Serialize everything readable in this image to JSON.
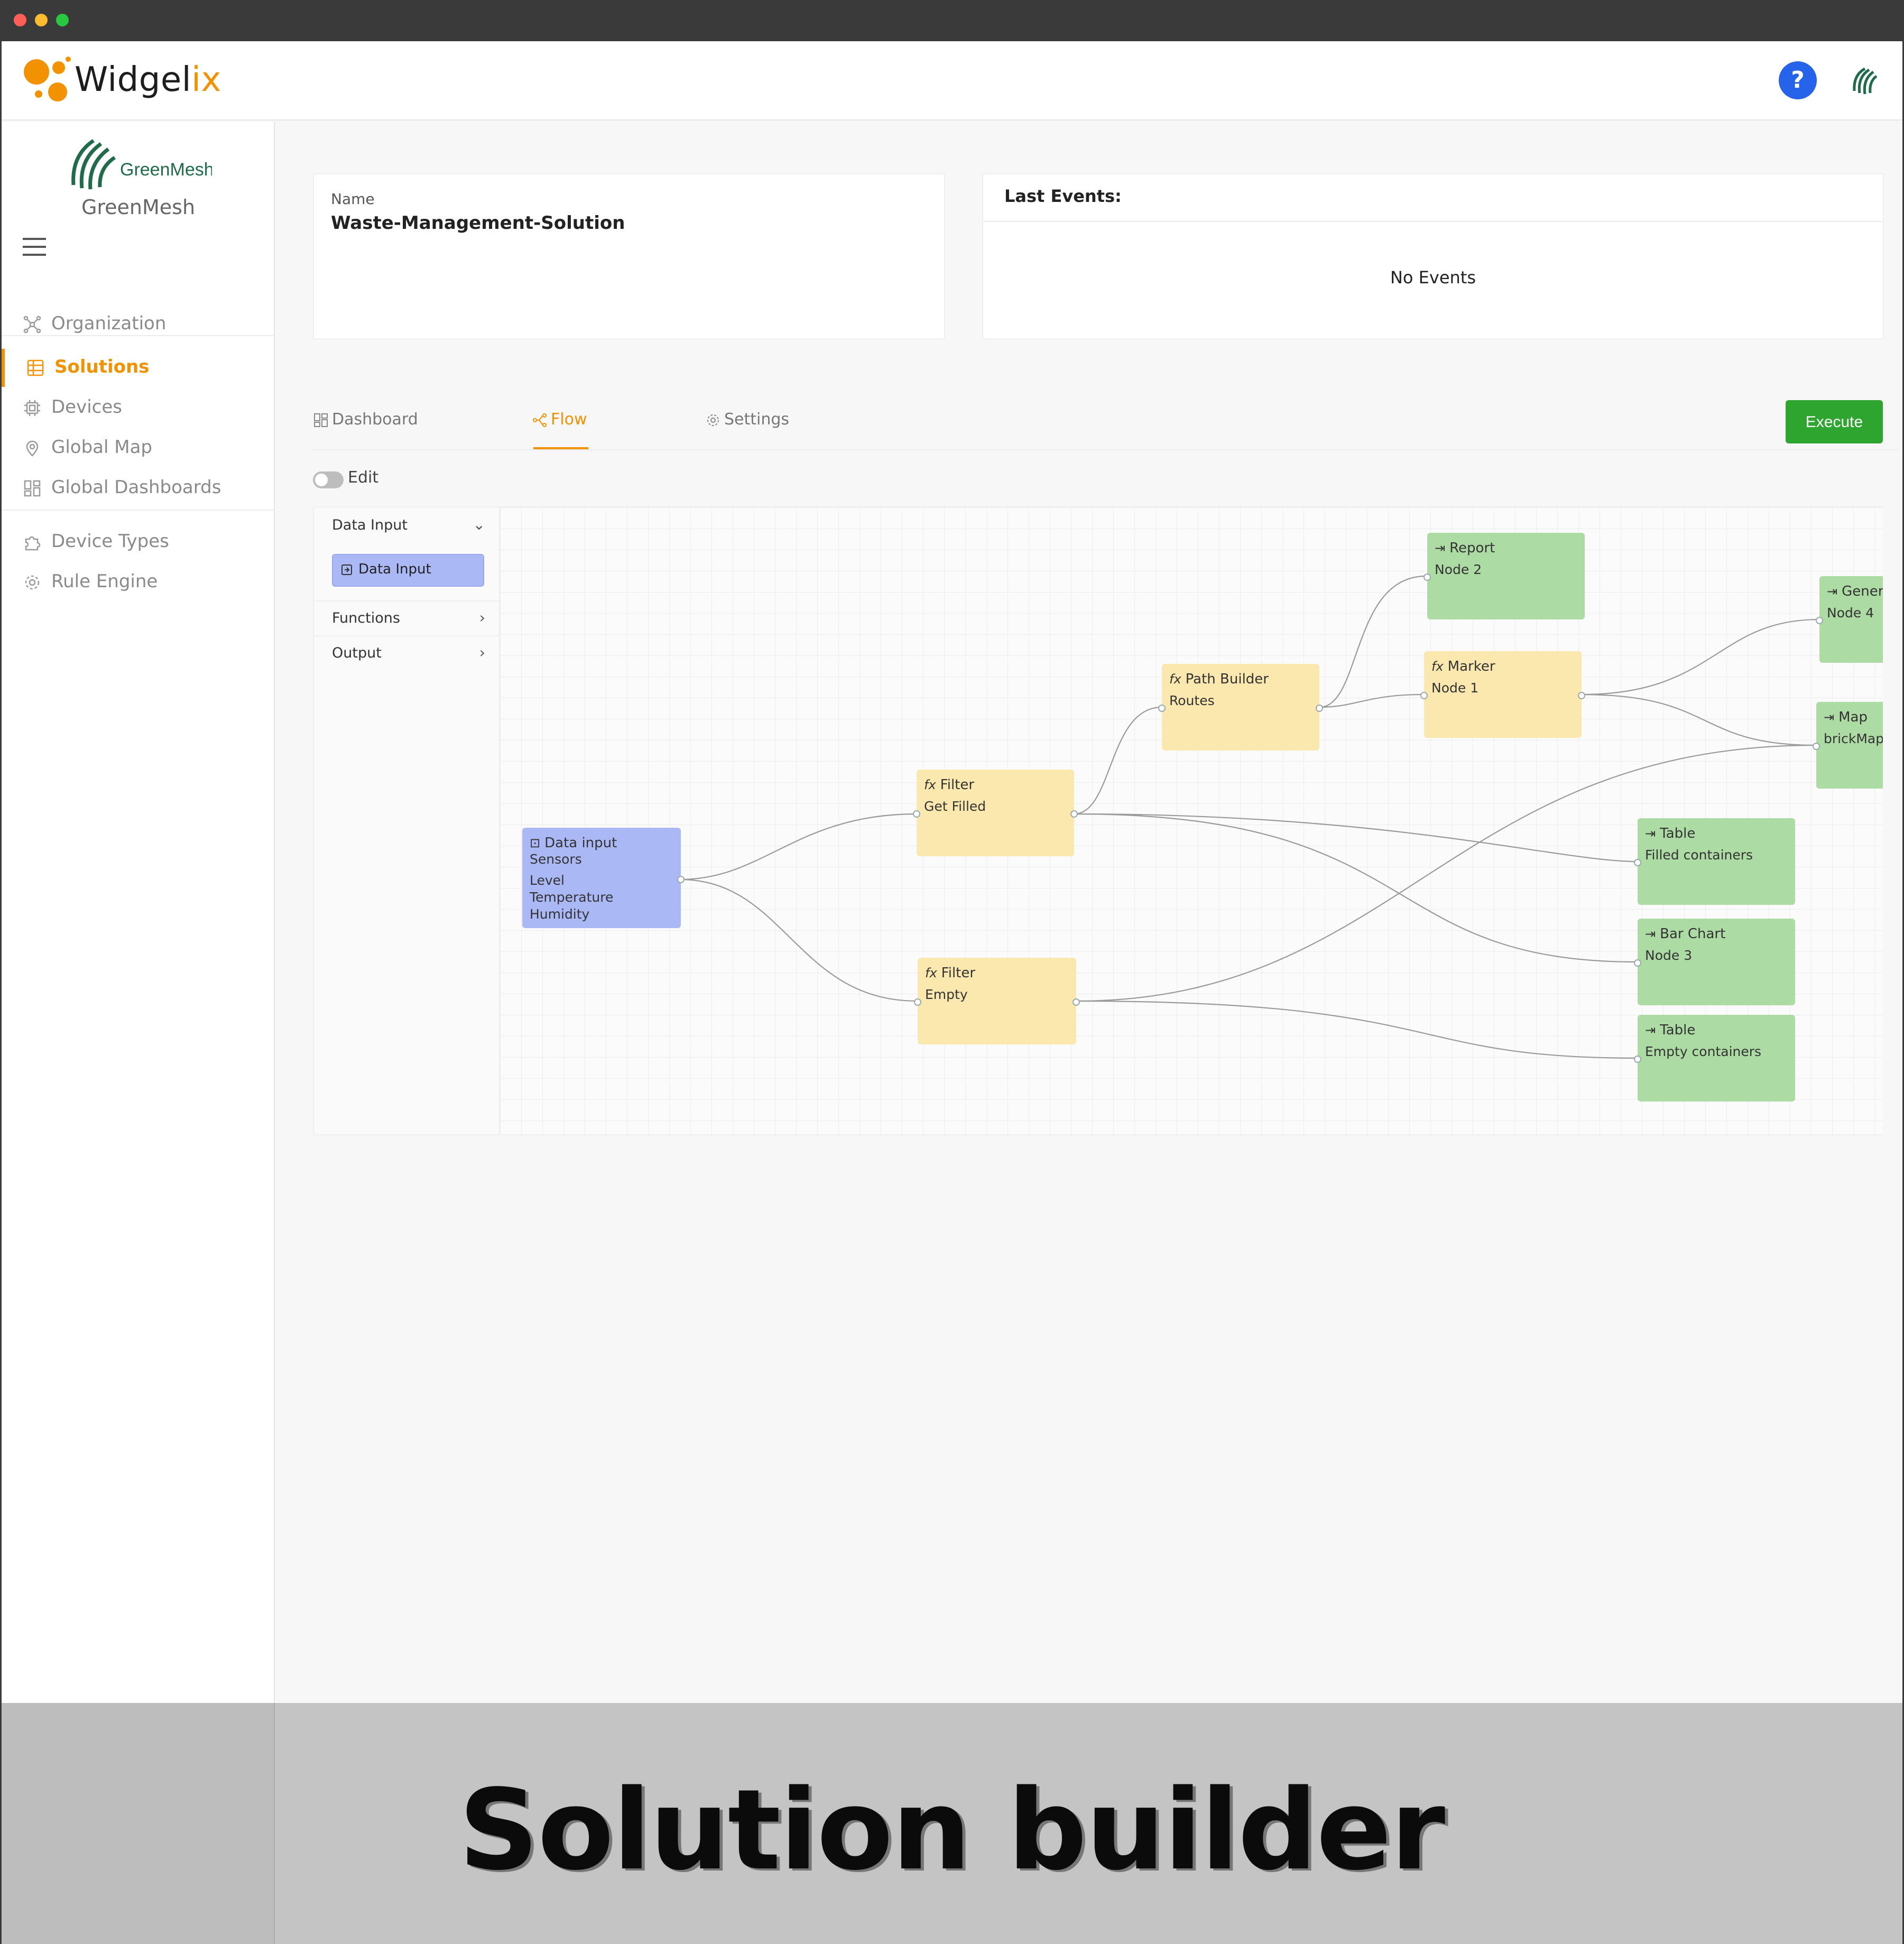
{
  "app": {
    "name_prefix": "Widgel",
    "name_suffix": "ix"
  },
  "header": {
    "help_label": "?"
  },
  "organization": {
    "logo_text": "GreenMesh",
    "name": "GreenMesh"
  },
  "sidebar": {
    "items": [
      {
        "label": "Organization",
        "icon": "organization-icon"
      },
      {
        "label": "Solutions",
        "icon": "solutions-icon",
        "active": true
      },
      {
        "label": "Devices",
        "icon": "devices-icon"
      },
      {
        "label": "Global Map",
        "icon": "map-pin-icon"
      },
      {
        "label": "Global Dashboards",
        "icon": "dashboard-icon"
      },
      {
        "label": "Device Types",
        "icon": "puzzle-icon"
      },
      {
        "label": "Rule Engine",
        "icon": "gear-icon"
      }
    ]
  },
  "solution": {
    "name_label": "Name",
    "name_value": "Waste-Management-Solution"
  },
  "events": {
    "title": "Last Events:",
    "empty": "No Events"
  },
  "tabs": [
    {
      "label": "Dashboard",
      "icon": "grid-icon"
    },
    {
      "label": "Flow",
      "icon": "flow-icon",
      "active": true
    },
    {
      "label": "Settings",
      "icon": "gear-icon"
    }
  ],
  "actions": {
    "execute": "Execute",
    "edit": "Edit"
  },
  "palette": {
    "sections": [
      {
        "label": "Data Input",
        "expanded": true,
        "chevron": "⌄"
      },
      {
        "label": "Functions",
        "expanded": false,
        "chevron": "›"
      },
      {
        "label": "Output",
        "expanded": false,
        "chevron": "›"
      }
    ],
    "chip": "Data Input"
  },
  "nodes": {
    "input": {
      "title": "Data input",
      "lines": [
        "Sensors",
        "Level",
        "Temperature",
        "Humidity"
      ]
    },
    "filter_filled": {
      "title": "Filter",
      "sub": "Get Filled"
    },
    "filter_empty": {
      "title": "Filter",
      "sub": "Empty"
    },
    "path_builder": {
      "title": "Path Builder",
      "sub": "Routes"
    },
    "report": {
      "title": "Report",
      "sub": "Node 2"
    },
    "marker": {
      "title": "Marker",
      "sub": "Node 1"
    },
    "gener": {
      "title": "Gener",
      "sub": "Node 4"
    },
    "map": {
      "title": "Map",
      "sub": "brickMap"
    },
    "table_filled": {
      "title": "Table",
      "sub": "Filled containers"
    },
    "bar_chart": {
      "title": "Bar Chart",
      "sub": "Node 3"
    },
    "table_empty": {
      "title": "Table",
      "sub": "Empty containers"
    }
  },
  "banner": {
    "text": "Solution builder"
  },
  "colors": {
    "accent": "#f39200",
    "execute": "#2ea52e",
    "input_node": "#aab8f5",
    "function_node": "#fbe8ae",
    "output_node": "#acdba3"
  }
}
